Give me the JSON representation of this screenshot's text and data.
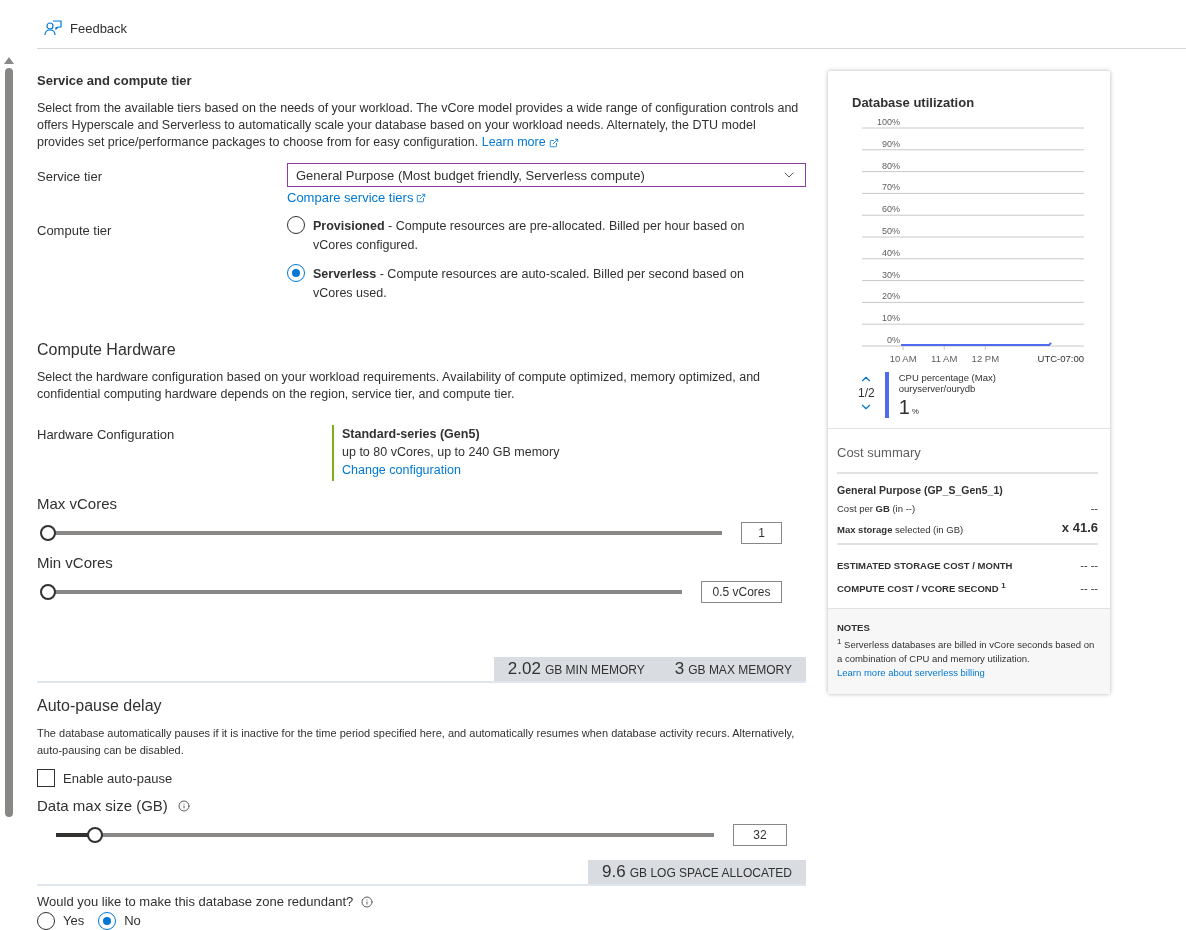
{
  "topbar": {
    "feedback": "Feedback"
  },
  "service_compute": {
    "title": "Service and compute tier",
    "description": "Select from the available tiers based on the needs of your workload. The vCore model provides a wide range of configuration controls and offers Hyperscale and Serverless to automatically scale your database based on your workload needs. Alternately, the DTU model provides set price/performance packages to choose from for easy configuration.",
    "learn_more": "Learn more",
    "service_tier": {
      "label": "Service tier",
      "value": "General Purpose (Most budget friendly, Serverless compute)",
      "link": "Compare service tiers"
    },
    "compute_tier": {
      "label": "Compute tier",
      "options": [
        {
          "name": "Provisioned",
          "description": " - Compute resources are pre-allocated. Billed per hour based on vCores configured.",
          "selected": false
        },
        {
          "name": "Serverless",
          "description": " - Compute resources are auto-scaled. Billed per second based on vCores used.",
          "selected": true
        }
      ]
    }
  },
  "hardware": {
    "title": "Compute Hardware",
    "description": "Select the hardware configuration based on your workload requirements. Availability of compute optimized, memory optimized, and confidential computing hardware depends on the region, service tier, and compute tier.",
    "config_label": "Hardware Configuration",
    "config_name": "Standard-series (Gen5)",
    "config_detail": "up to 80 vCores, up to 240 GB memory",
    "change_link": "Change configuration"
  },
  "vcores": [
    {
      "label": "Max vCores",
      "level": 0,
      "value": "1"
    },
    {
      "label": "Min vCores",
      "level": 0,
      "value": "0.5 vCores"
    }
  ],
  "memory": [
    {
      "value": "2.02",
      "unit": "GB MIN MEMORY"
    },
    {
      "value": "3",
      "unit": "GB MAX MEMORY"
    }
  ],
  "auto_pause": {
    "title": "Auto-pause delay",
    "description": "The database automatically pauses if it is inactive for the time period specified here, and automatically resumes when database activity recurs. Alternatively, auto-pausing can be disabled.",
    "checkbox": {
      "label": "Enable auto-pause",
      "checked": false
    }
  },
  "data_max_size": {
    "label": "Data max size (GB)",
    "level": 0.06,
    "value": "32"
  },
  "log_space": {
    "value": "9.6",
    "unit": "GB LOG SPACE ALLOCATED"
  },
  "zone_redundant": {
    "question": "Would you like to make this database zone redundant?",
    "options": [
      {
        "label": "Yes",
        "selected": false
      },
      {
        "label": "No",
        "selected": true
      }
    ]
  },
  "utilization": {
    "title": "Database utilization",
    "chart_data": {
      "type": "line",
      "grid": true,
      "xlabel": "UTC-07:00",
      "x": [
        9.95,
        13.55,
        13.6
      ],
      "series": [
        {
          "name": "CPU percentage (Max)",
          "color": "#4f6bed",
          "values": [
            0,
            0,
            1
          ]
        }
      ],
      "xlim": [
        9,
        14.4
      ],
      "ylim": [
        0,
        100
      ],
      "xticks": [
        {
          "value": 10,
          "label": "10 AM"
        },
        {
          "value": 11,
          "label": "11 AM"
        },
        {
          "value": 12,
          "label": "12 PM"
        }
      ],
      "yticks": [
        {
          "value": 0,
          "label": "0%"
        },
        {
          "value": 10,
          "label": "10%"
        },
        {
          "value": 20,
          "label": "20%"
        },
        {
          "value": 30,
          "label": "30%"
        },
        {
          "value": 40,
          "label": "40%"
        },
        {
          "value": 50,
          "label": "50%"
        },
        {
          "value": 60,
          "label": "60%"
        },
        {
          "value": 70,
          "label": "70%"
        },
        {
          "value": 80,
          "label": "80%"
        },
        {
          "value": 90,
          "label": "90%"
        },
        {
          "value": 100,
          "label": "100%"
        }
      ]
    },
    "legend": {
      "pager": "1/2",
      "resource": "ouryserver/ourydb",
      "value": "1",
      "unit": "%"
    }
  },
  "cost_summary": {
    "title": "Cost summary",
    "tier": "General Purpose (GP_S_Gen5_1)",
    "rows": [
      {
        "label": "Cost per **GB** (in --)",
        "value": "--"
      },
      {
        "label": "**Max storage** selected (in GB)",
        "value": "x 41.6"
      }
    ],
    "totals": [
      {
        "label": "ESTIMATED STORAGE COST / MONTH",
        "value": "-- --"
      },
      {
        "label": "COMPUTE COST / VCORE SECOND $^{1}$",
        "value": "-- --"
      }
    ],
    "notes": {
      "title": "NOTES",
      "text": "$^{1}$ Serverless databases are billed in vCore seconds based on a combination of CPU and memory utilization.",
      "link": "Learn more about serverless billing"
    }
  }
}
